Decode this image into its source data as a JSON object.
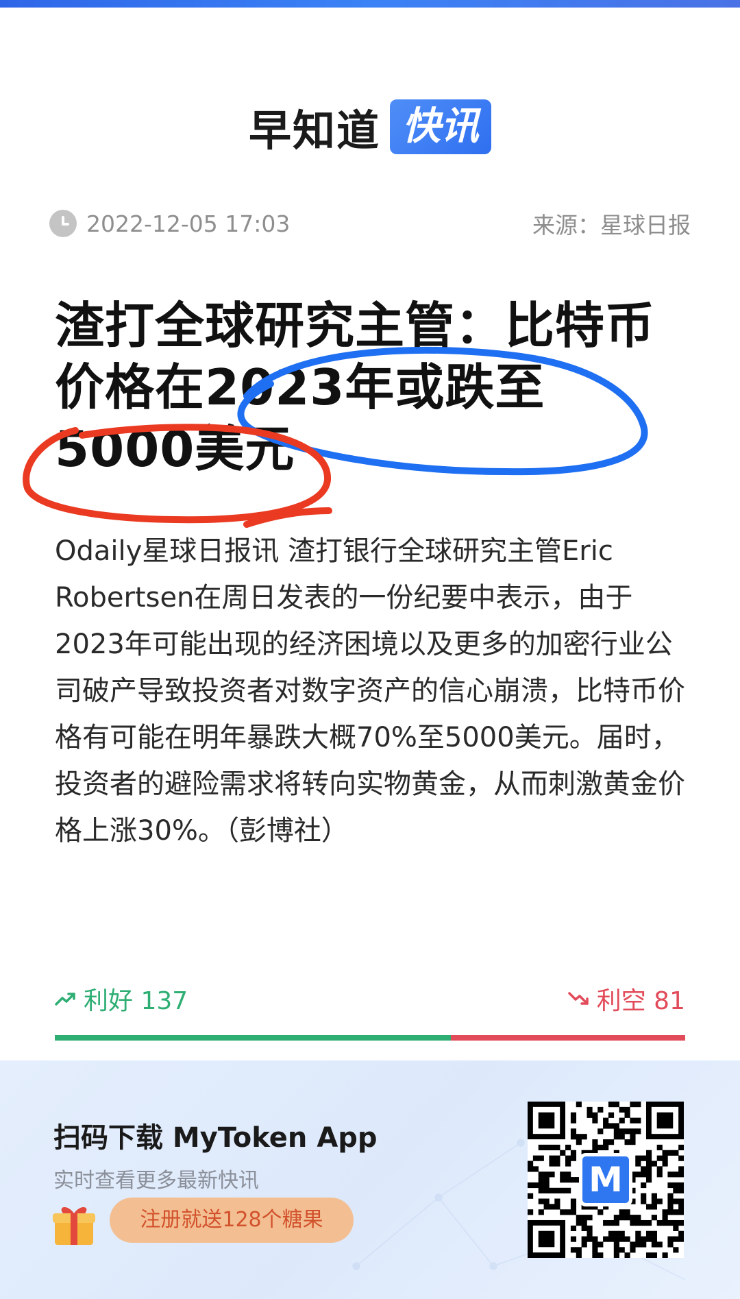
{
  "header": {
    "brand_name": "早知道",
    "brand_badge": "快讯"
  },
  "meta": {
    "time_icon": "clock-icon",
    "timestamp": "2022-12-05 17:03",
    "source": "来源：星球日报"
  },
  "article": {
    "headline": "渣打全球研究主管：比特币价格在2023年或跌至5000美元",
    "body": "Odaily星球日报讯 渣打银行全球研究主管Eric Robertsen在周日发表的一份纪要中表示，由于2023年可能出现的经济困境以及更多的加密行业公司破产导致投资者对数字资产的信心崩溃，比特币价格有可能在明年暴跌大概70%至5000美元。届时，投资者的避险需求将转向实物黄金，从而刺激黄金价格上涨30%。（彭博社）"
  },
  "votes": {
    "bull_label": "利好 137",
    "bear_label": "利空 81",
    "bull_count": 137,
    "bear_count": 81,
    "bull_color": "#2fae74",
    "bear_color": "#e24b5a",
    "bull_icon": "trend-up-icon",
    "bear_icon": "trend-down-icon"
  },
  "annotations": {
    "blue_color": "#1f6ff2",
    "red_color": "#ea3a22"
  },
  "promo": {
    "title": "扫码下载 MyToken App",
    "subtitle": "实时查看更多最新快讯",
    "gift_icon": "gift-icon",
    "cta_label": "注册就送128个糖果",
    "qr_icon": "qr-code",
    "logo_letter": "M"
  }
}
